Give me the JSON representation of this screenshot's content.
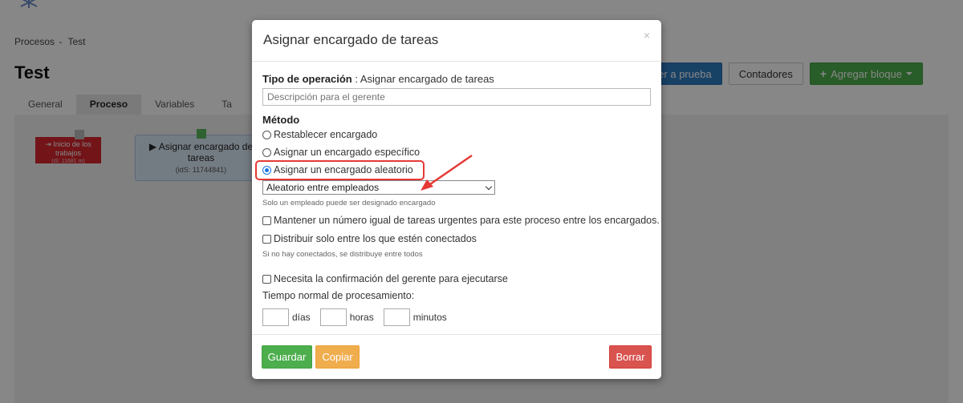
{
  "breadcrumb": {
    "parent": "Procesos",
    "separator": "-",
    "current": "Test"
  },
  "page": {
    "title": "Test"
  },
  "toolbar": {
    "test_label": "Poner a prueba",
    "counters_label": "Contadores",
    "add_block_label": "Agregar bloque"
  },
  "tabs": [
    "General",
    "Proceso",
    "Variables",
    "Ta"
  ],
  "nodes": {
    "start": {
      "label": "Inicio de los trabajos",
      "id": "(iS: 11681 m)"
    },
    "task": {
      "label": "Asignar encargado de tareas",
      "id": "(idS: 11744841)"
    }
  },
  "modal": {
    "title": "Asignar encargado de tareas",
    "close": "×",
    "operation_label": "Tipo de operación",
    "operation_value": ": Asignar encargado de tareas",
    "description_placeholder": "Descripción para el gerente",
    "method_label": "Método",
    "methods": [
      "Restablecer encargado",
      "Asignar un encargado específico",
      "Asignar un encargado aleatorio"
    ],
    "random_select_value": "Aleatorio entre empleados",
    "random_help": "Solo un empleado puede ser designado encargado",
    "check_equal_urgent": "Mantener un número igual de tareas urgentes para este proceso entre los encargados.",
    "check_connected": "Distribuir solo entre los que estén conectados",
    "connected_help": "Si no hay conectados, se distribuye entre todos",
    "check_confirmation": "Necesita la confirmación del gerente para ejecutarse",
    "time_label": "Tiempo normal de procesamiento:",
    "units": {
      "days": "días",
      "hours": "horas",
      "minutes": "minutos"
    },
    "buttons": {
      "save": "Guardar",
      "copy": "Copiar",
      "delete": "Borrar"
    }
  },
  "colors": {
    "primary": "#2e7bc0",
    "success": "#4cae4c",
    "warning": "#f0ad4e",
    "danger": "#d9534f",
    "highlight": "#e53935"
  }
}
